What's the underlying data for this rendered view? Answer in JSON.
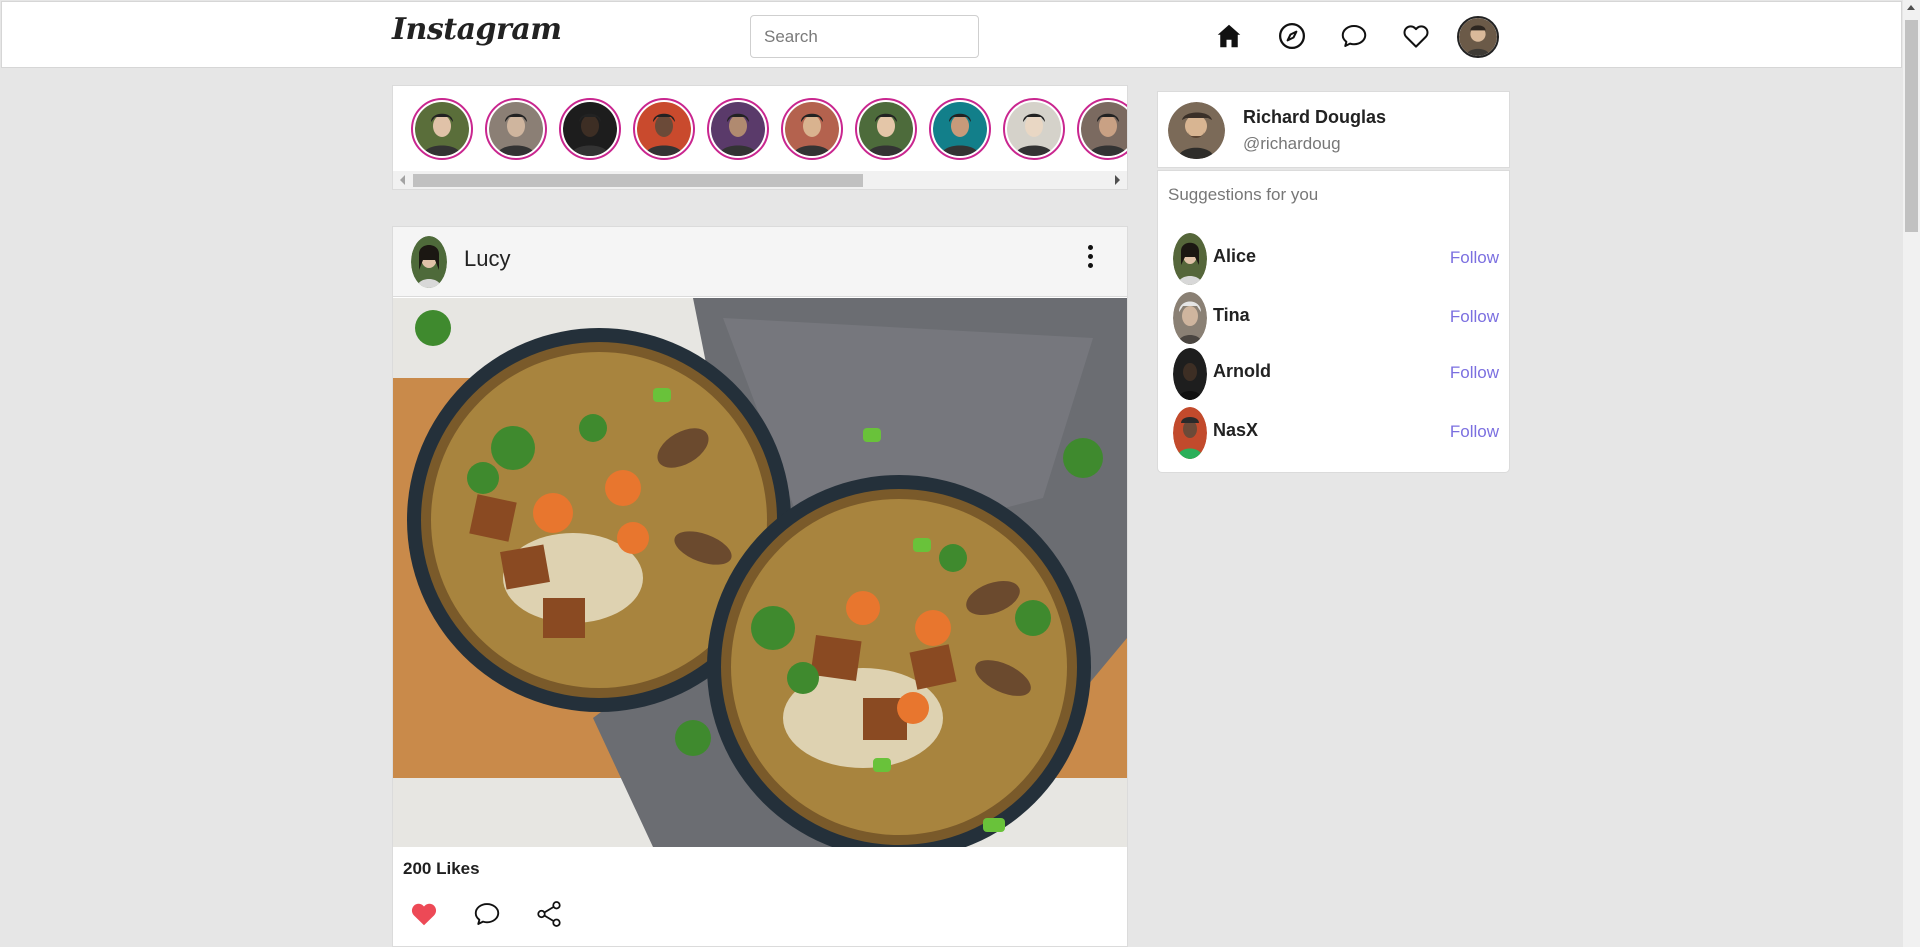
{
  "nav": {
    "logo": "Instagram",
    "search_placeholder": "Search",
    "icons": [
      "home-icon",
      "compass-icon",
      "messages-icon",
      "heart-icon"
    ]
  },
  "stories": [
    {
      "name": "story-1",
      "color": "#5a6e3a"
    },
    {
      "name": "story-2",
      "color": "#8b7f75"
    },
    {
      "name": "story-3",
      "color": "#1d1d1d"
    },
    {
      "name": "story-4",
      "color": "#c94a2d"
    },
    {
      "name": "story-5",
      "color": "#5a3a6a"
    },
    {
      "name": "story-6",
      "color": "#b4624e"
    },
    {
      "name": "story-7",
      "color": "#4d6b3b"
    },
    {
      "name": "story-8",
      "color": "#127f8a"
    },
    {
      "name": "story-9",
      "color": "#d5d2ca"
    },
    {
      "name": "story-10",
      "color": "#7b6a60"
    }
  ],
  "post": {
    "user": "Lucy",
    "likes": "200 Likes"
  },
  "profile": {
    "name": "Richard Douglas",
    "handle": "@richardoug"
  },
  "suggestions": {
    "title": "Suggestions for you",
    "follow_label": "Follow",
    "users": [
      {
        "name": "Alice",
        "color": "#55663a"
      },
      {
        "name": "Tina",
        "color": "#8a8074"
      },
      {
        "name": "Arnold",
        "color": "#1e1e1e"
      },
      {
        "name": "NasX",
        "color": "#c24a2c"
      }
    ]
  },
  "colors": {
    "accent_follow": "#7b6fe0",
    "story_ring": "#c9268f",
    "like_red": "#ed4956"
  }
}
